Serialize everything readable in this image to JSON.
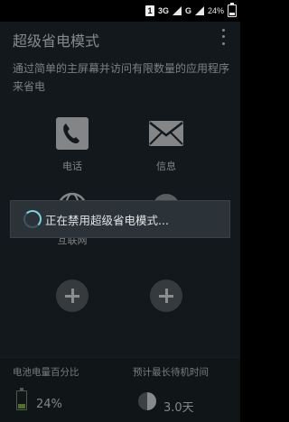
{
  "status_bar": {
    "sim": "1",
    "network_type": "3G",
    "network_sub": "2",
    "network_secondary": "G",
    "battery_percent": "24%",
    "battery_level": 0.24
  },
  "app": {
    "title": "超级省电模式",
    "description": "通过简单的主屏幕并访问有限数量的应用程序来省电",
    "apps": [
      {
        "label": "电话",
        "icon": "phone-icon"
      },
      {
        "label": "信息",
        "icon": "message-icon"
      },
      {
        "label": "互联网",
        "icon": "internet-icon"
      },
      {
        "label": "",
        "icon": "app-icon"
      }
    ],
    "add_buttons": [
      "add-icon",
      "add-icon"
    ]
  },
  "footer": {
    "battery_title": "电池电量百分比",
    "battery_value": "24%",
    "battery_level": 0.24,
    "standby_title": "预计最长待机时间",
    "standby_value": "3.0天"
  },
  "dialog": {
    "message": "正在禁用超级省电模式..."
  },
  "colors": {
    "background": "#1e262b",
    "accent": "#7fd2e8",
    "battery_green": "#7fae3e"
  }
}
